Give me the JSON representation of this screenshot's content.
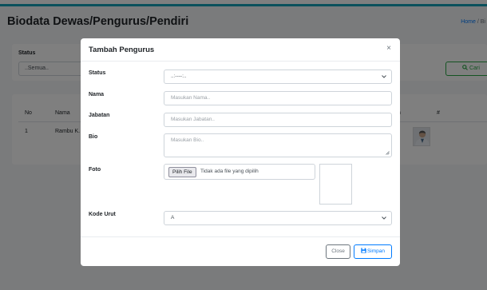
{
  "page": {
    "title": "Biodata Dewas/Pengurus/Pendiri",
    "breadcrumb": {
      "home": "Home",
      "separator": "/",
      "current": "Bi"
    }
  },
  "filter": {
    "status_label": "Status",
    "status_value": "..Semua..",
    "search_label": "Cari",
    "search_icon": "search-icon"
  },
  "table": {
    "headers": {
      "no": "No",
      "nama": "Nama",
      "jabatan_partial": "n",
      "aksi": "#"
    },
    "rows": [
      {
        "no": "1",
        "nama": "Rambu K."
      }
    ]
  },
  "modal": {
    "title": "Tambah Pengurus",
    "close_symbol": "×",
    "fields": {
      "status": {
        "label": "Status",
        "value": "..:----:.."
      },
      "nama": {
        "label": "Nama",
        "placeholder": "Masukan Nama.."
      },
      "jabatan": {
        "label": "Jabatan",
        "placeholder": "Masukan Jabatan.."
      },
      "bio": {
        "label": "Bio",
        "placeholder": "Masukan Bio.."
      },
      "foto": {
        "label": "Foto",
        "button": "Pilih File",
        "no_file_text": "Tidak ada file yang dipilih"
      },
      "kode_urut": {
        "label": "Kode Urut",
        "value": "A"
      }
    },
    "footer": {
      "close_label": "Close",
      "save_label": "Simpan",
      "save_icon": "save-icon"
    }
  },
  "colors": {
    "accent": "#17a2b8",
    "primary": "#007bff",
    "success": "#28a745",
    "secondary": "#6c757d"
  }
}
